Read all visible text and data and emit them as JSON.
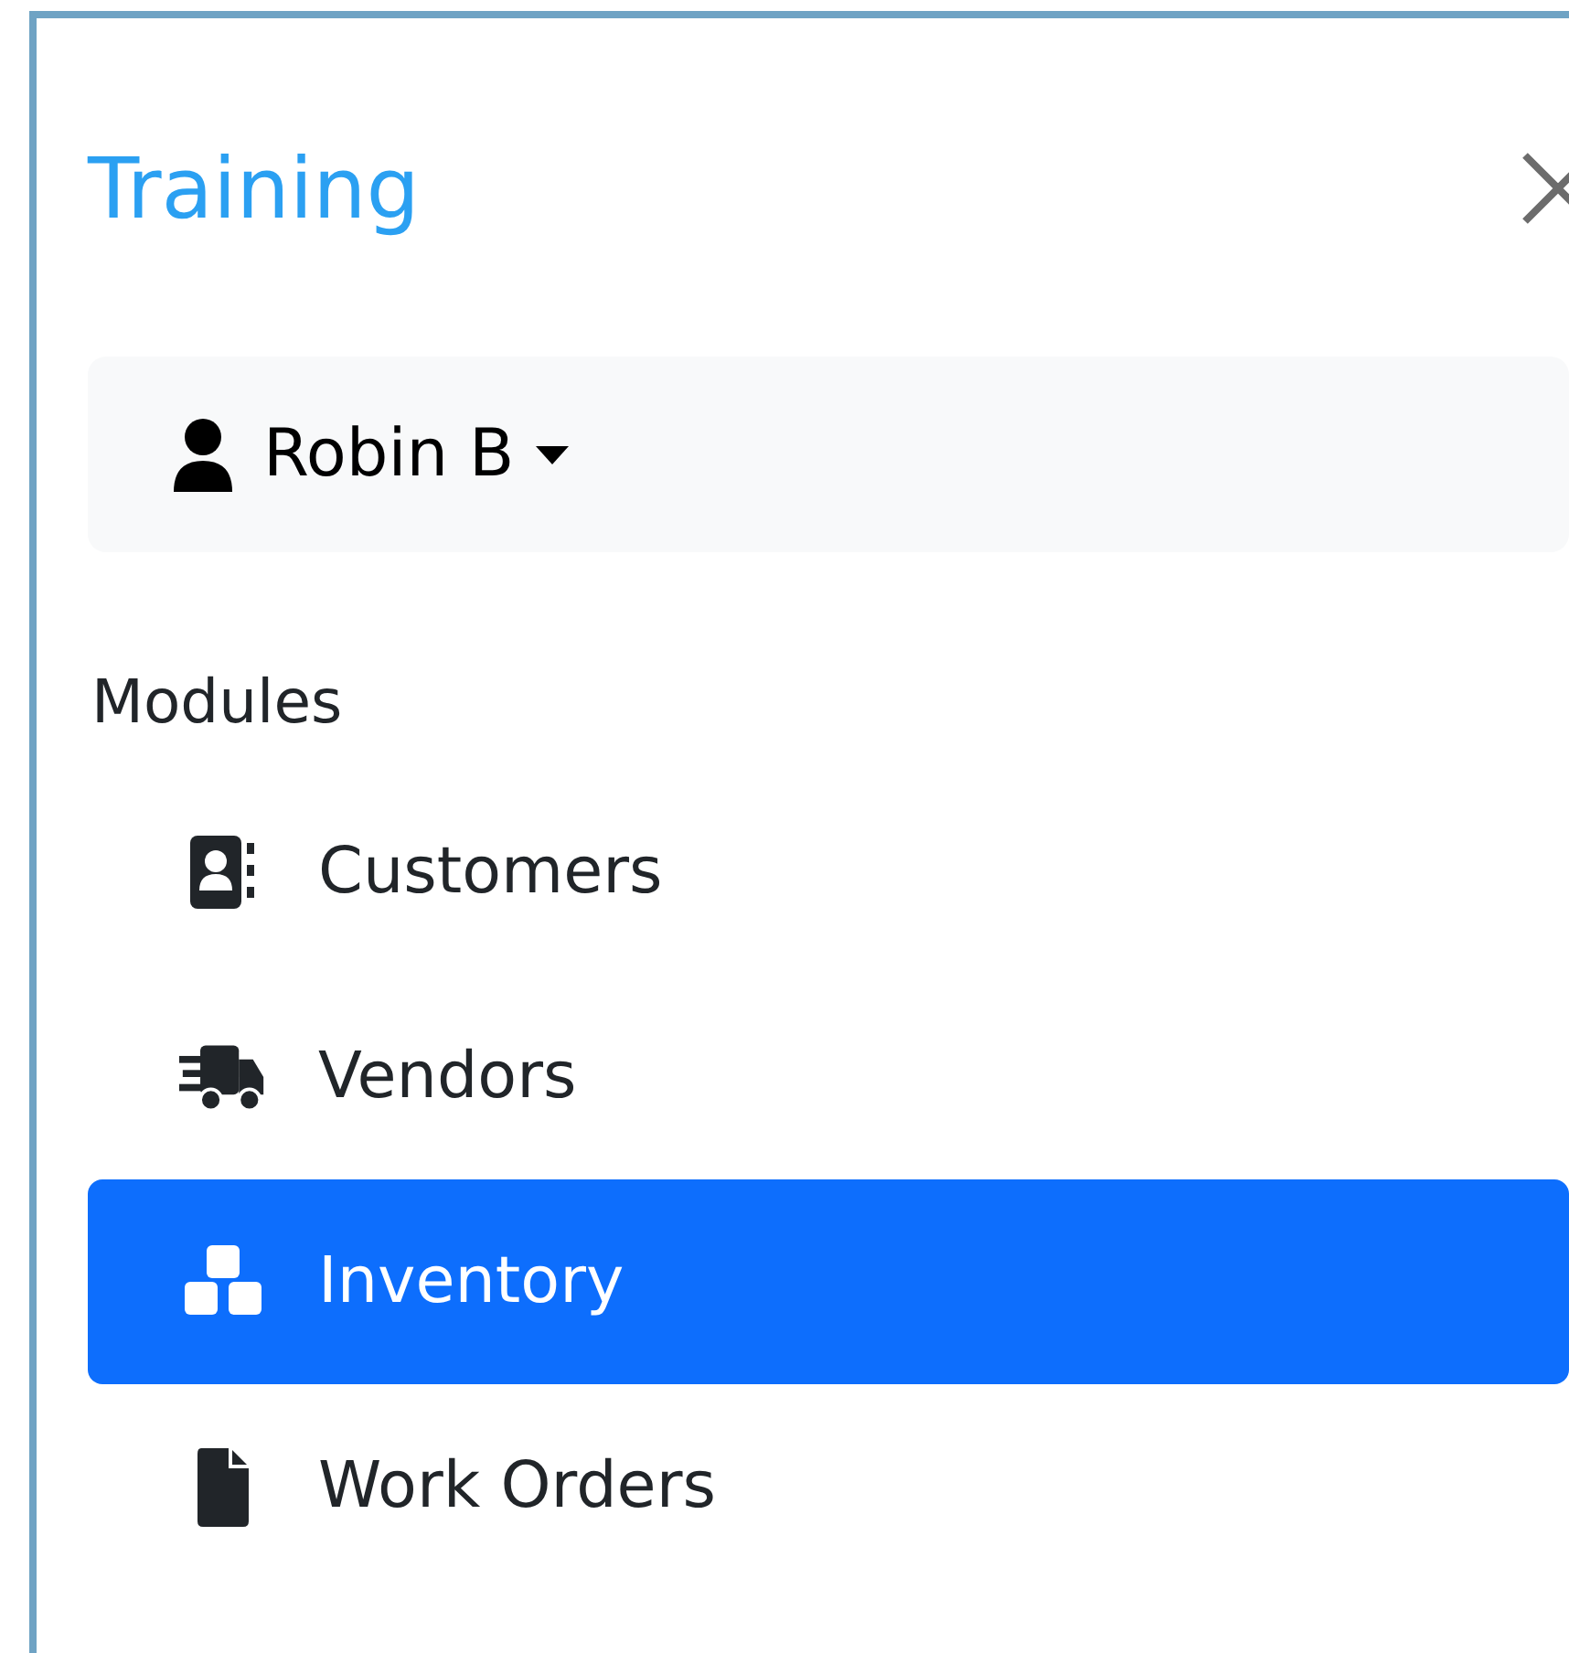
{
  "title": "Training",
  "user": {
    "name": "Robin B"
  },
  "modules": {
    "heading": "Modules",
    "items": [
      {
        "label": "Customers",
        "selected": false
      },
      {
        "label": "Vendors",
        "selected": false
      },
      {
        "label": "Inventory",
        "selected": true
      },
      {
        "label": "Work Orders",
        "selected": false
      }
    ]
  }
}
